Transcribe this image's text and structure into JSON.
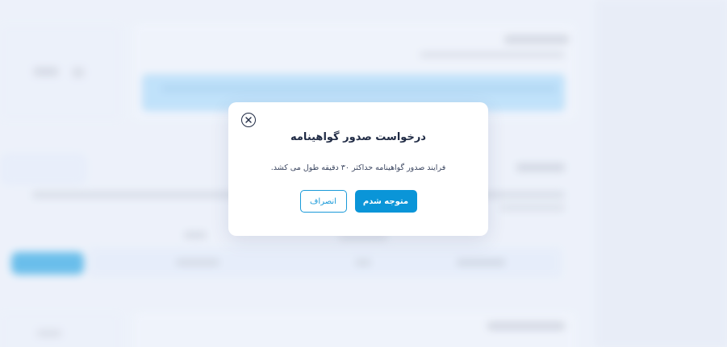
{
  "dialog": {
    "title": "درخواست صدور گواهینامه",
    "message": "فرایند صدور گواهینامه حداکثر ۳۰ دقیقه طول می کشد.",
    "cancel_label": "انصراف",
    "confirm_label": "متوجه شدم",
    "close_icon": "close-icon"
  },
  "colors": {
    "accent": "#0a95d8",
    "title_text": "#1f2a44",
    "background": "#eef2fb"
  }
}
